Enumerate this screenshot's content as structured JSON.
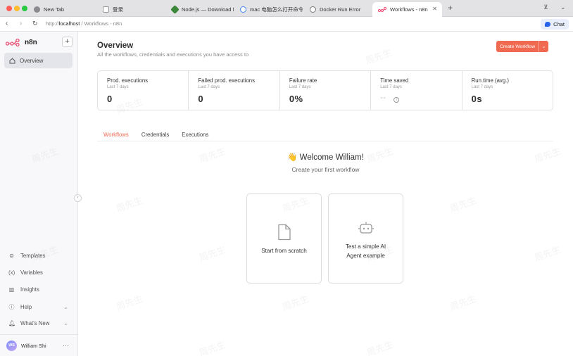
{
  "browser": {
    "tabs": [
      {
        "label": "New Tab",
        "color": "#8a8a8f"
      },
      {
        "label": "登录",
        "color": "#ffffff"
      },
      {
        "label": "Node.js — Download N",
        "color": "#3c873a"
      },
      {
        "label": "mac 电脑怎么打开命令行",
        "color": "#4285f4"
      },
      {
        "label": "Docker Run Error",
        "color": "#777777"
      },
      {
        "label": "Workflows - n8n",
        "color": "#ea4b71"
      }
    ],
    "new_tab": "+",
    "url_prefix": "http://",
    "url_host": "localhost",
    "url_path": " / Workflows - n8n",
    "chat_label": "Chat"
  },
  "sidebar": {
    "brand": "n8n",
    "add": "+",
    "active_item": "Overview",
    "items": [
      {
        "label": "Templates",
        "icon": "box-icon"
      },
      {
        "label": "Variables",
        "icon": "variables-icon"
      },
      {
        "label": "Insights",
        "icon": "chart-icon"
      },
      {
        "label": "Help",
        "icon": "help-icon"
      },
      {
        "label": "What's New",
        "icon": "bell-icon"
      }
    ],
    "user": {
      "initials": "WS",
      "name": "William Shi",
      "more": "···"
    }
  },
  "main": {
    "title": "Overview",
    "subtitle": "All the workflows, credentials and executions you have access to",
    "create_button": "Create Workflow",
    "stats": [
      {
        "title": "Prod. executions",
        "period": "Last 7 days",
        "value": "0"
      },
      {
        "title": "Failed prod. executions",
        "period": "Last 7 days",
        "value": "0"
      },
      {
        "title": "Failure rate",
        "period": "Last 7 days",
        "value": "0%"
      },
      {
        "title": "Time saved",
        "period": "Last 7 days",
        "value": "--"
      },
      {
        "title": "Run time (avg.)",
        "period": "Last 7 days",
        "value": "0s"
      }
    ],
    "tabs": [
      "Workflows",
      "Credentials",
      "Executions"
    ],
    "welcome": "👋 Welcome William!",
    "welcome_sub": "Create your first workflow",
    "cards": [
      {
        "label": "Start from scratch"
      },
      {
        "line1": "Test a simple AI",
        "line2": "Agent example"
      }
    ]
  },
  "watermark": "周先生",
  "colors": {
    "accent": "#f06a52",
    "brand": "#ea4b71"
  }
}
